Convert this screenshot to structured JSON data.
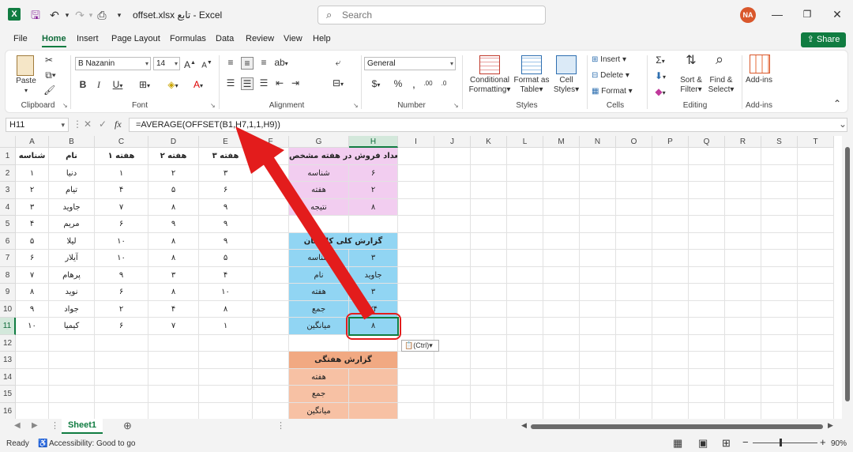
{
  "app": {
    "title": "offset.xlsx تابع  -  Excel",
    "search_placeholder": "Search",
    "user_initials": "NA"
  },
  "menu": [
    "File",
    "Home",
    "Insert",
    "Page Layout",
    "Formulas",
    "Data",
    "Review",
    "View",
    "Help"
  ],
  "share_label": "Share",
  "ribbon": {
    "clipboard": {
      "paste": "Paste",
      "label": "Clipboard"
    },
    "font": {
      "name": "B Nazanin",
      "size": "14",
      "label": "Font"
    },
    "alignment": {
      "label": "Alignment"
    },
    "number": {
      "format": "General",
      "label": "Number"
    },
    "styles": {
      "conditional_1": "Conditional",
      "conditional_2": "Formatting",
      "format_as_1": "Format as",
      "format_as_2": "Table",
      "cell_styles_1": "Cell",
      "cell_styles_2": "Styles",
      "label": "Styles"
    },
    "cells": {
      "insert": "Insert",
      "delete": "Delete",
      "format": "Format",
      "label": "Cells"
    },
    "editing": {
      "sort_1": "Sort &",
      "sort_2": "Filter",
      "find_1": "Find &",
      "find_2": "Select",
      "label": "Editing"
    },
    "addins": {
      "addins": "Add-ins",
      "label": "Add-ins"
    }
  },
  "formula_bar": {
    "name_box": "H11",
    "formula": "=AVERAGE(OFFSET(B1,H7,1,1,H9))"
  },
  "columns": [
    "A",
    "B",
    "C",
    "D",
    "E",
    "F",
    "G",
    "H",
    "I",
    "J",
    "K",
    "L",
    "M",
    "N",
    "O",
    "P",
    "Q",
    "R",
    "S",
    "T"
  ],
  "rows": [
    "1",
    "2",
    "3",
    "4",
    "5",
    "6",
    "7",
    "8",
    "9",
    "10",
    "11",
    "12",
    "13",
    "14",
    "15",
    "16"
  ],
  "table": {
    "headers": [
      "شناسه",
      "نام",
      "هفته ۱",
      "هفته ۲",
      "هفته ۳"
    ],
    "data": [
      [
        "۱",
        "دنیا",
        "۱",
        "۲",
        "۳"
      ],
      [
        "۲",
        "تیام",
        "۴",
        "۵",
        "۶"
      ],
      [
        "۳",
        "جاوید",
        "۷",
        "۸",
        "۹"
      ],
      [
        "۴",
        "مریم",
        "۶",
        "۹",
        "۹"
      ],
      [
        "۵",
        "لیلا",
        "۱۰",
        "۸",
        "۹"
      ],
      [
        "۶",
        "آیلار",
        "۱۰",
        "۸",
        "۵"
      ],
      [
        "۷",
        "پرهام",
        "۹",
        "۳",
        "۴"
      ],
      [
        "۸",
        "نوید",
        "۶",
        "۸",
        "۱۰"
      ],
      [
        "۹",
        "جواد",
        "۲",
        "۴",
        "۸"
      ],
      [
        "۱۰",
        "کیمیا",
        "۶",
        "۷",
        "۱"
      ]
    ]
  },
  "report_week": {
    "title": "تعداد فروش در هفته مشخص",
    "rows": [
      [
        "شناسه",
        "۶"
      ],
      [
        "هفته",
        "۲"
      ],
      [
        "نتیجه",
        "۸"
      ]
    ]
  },
  "report_summary": {
    "title": "گزارش کلی کارکنان",
    "rows": [
      [
        "شناسه",
        "۳"
      ],
      [
        "نام",
        "جاوید"
      ],
      [
        "هفته",
        "۳"
      ],
      [
        "جمع",
        "۲۴"
      ],
      [
        "میانگین",
        "۸"
      ]
    ]
  },
  "report_weekly": {
    "title": "گزارش هفتگی",
    "rows": [
      "هفته",
      "جمع",
      "میانگین"
    ]
  },
  "paste_options": "(Ctrl)",
  "sheet_tab": "Sheet1",
  "status": {
    "ready": "Ready",
    "accessibility": "Accessibility: Good to go",
    "zoom": "90%"
  },
  "colors": {
    "excel_green": "#107c41",
    "pink": "#f2cdf0",
    "blue": "#91d5f3",
    "orange": "#f7c1a4",
    "arrow_red": "#e31c1c"
  }
}
